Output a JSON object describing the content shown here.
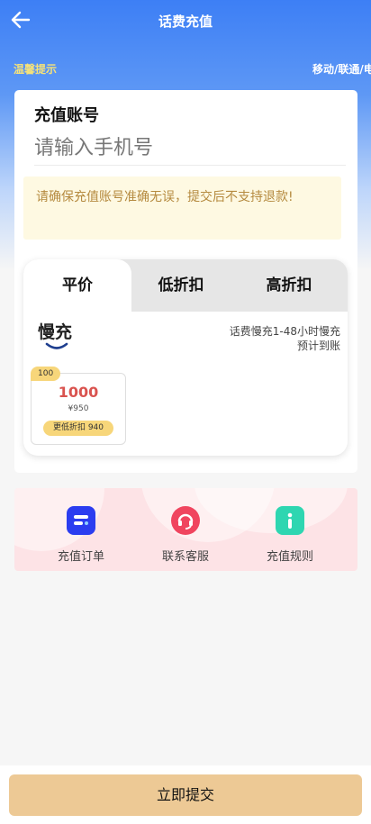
{
  "header": {
    "title": "话费充值",
    "back_icon": "arrow-left-icon"
  },
  "tips": {
    "left": "温馨提示",
    "right": "移动/联通/电信"
  },
  "account": {
    "label": "充值账号",
    "placeholder": "请输入手机号",
    "value": ""
  },
  "notice": "请确保充值账号准确无误，提交后不支持退款!",
  "tabs": [
    {
      "label": "平价",
      "active": true
    },
    {
      "label": "低折扣",
      "active": false
    },
    {
      "label": "高折扣",
      "active": false
    }
  ],
  "brand": {
    "name": "慢充"
  },
  "speed_note": {
    "line1": "话费慢充1-48小时慢充",
    "line2": "预计到账"
  },
  "package": {
    "tag": "100",
    "amount": "1000",
    "price": "¥950",
    "discount": "更低折扣 940"
  },
  "quick_links": [
    {
      "label": "充值订单",
      "icon": "order-list-icon",
      "color": "#2b3df0"
    },
    {
      "label": "联系客服",
      "icon": "customer-service-icon",
      "color": "#f0455f"
    },
    {
      "label": "充值规则",
      "icon": "info-icon",
      "color": "#2ed6b1"
    }
  ],
  "submit": {
    "label": "立即提交"
  },
  "colors": {
    "header_blue": "#3d7ff5",
    "tip_yellow": "#f5e27a",
    "submit_bg": "#edc995",
    "amount_red": "#d9534f"
  }
}
